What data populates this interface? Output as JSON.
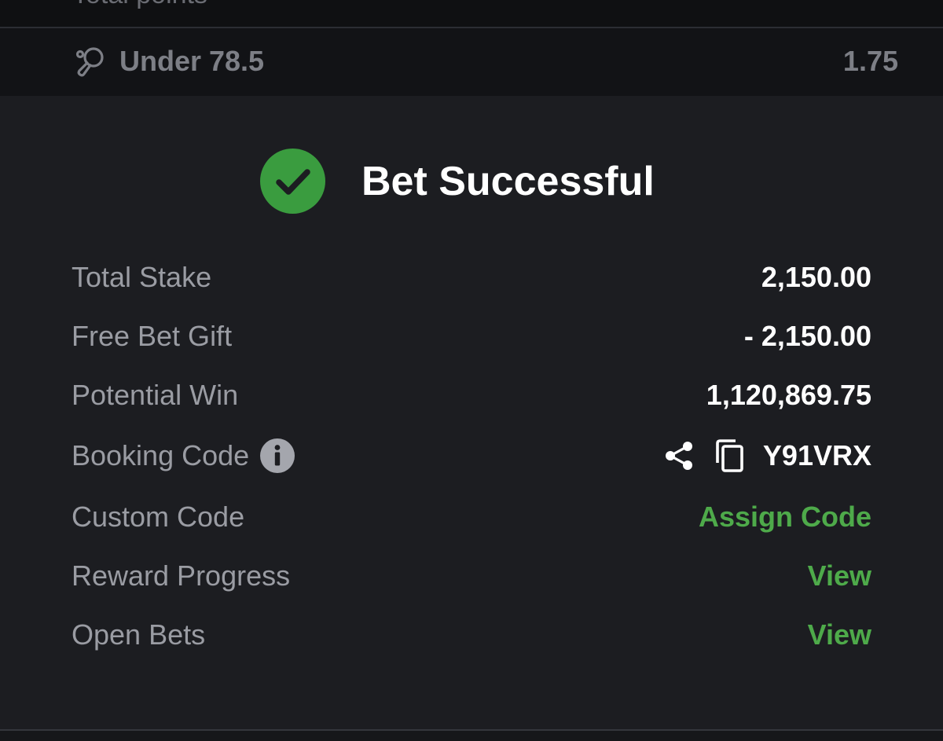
{
  "market": {
    "cropped_label": "Total points"
  },
  "selection": {
    "icon": "table-tennis-icon",
    "label": "Under 78.5",
    "odds": "1.75"
  },
  "confirmation": {
    "icon": "check-circle-icon",
    "title": "Bet Successful",
    "accent_color": "#3a9c3f"
  },
  "details": {
    "total_stake": {
      "label": "Total Stake",
      "value": "2,150.00"
    },
    "free_bet_gift": {
      "label": "Free Bet Gift",
      "value": "- 2,150.00"
    },
    "potential_win": {
      "label": "Potential Win",
      "value": "1,120,869.75"
    },
    "booking_code": {
      "label": "Booking Code",
      "value": "Y91VRX",
      "icons": [
        "info-icon",
        "share-icon",
        "copy-icon"
      ]
    },
    "custom_code": {
      "label": "Custom Code",
      "action": "Assign Code"
    },
    "reward_progress": {
      "label": "Reward Progress",
      "action": "View"
    },
    "open_bets": {
      "label": "Open Bets",
      "action": "View"
    }
  },
  "colors": {
    "background": "#1c1d21",
    "link": "#4eaa4a",
    "label": "#9a9ca3"
  }
}
